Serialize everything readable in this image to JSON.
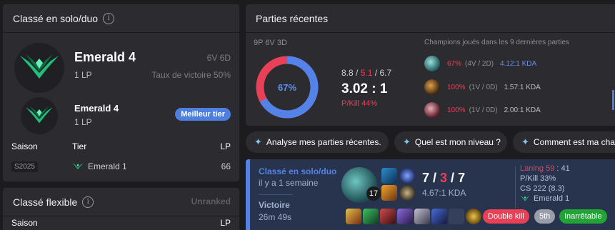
{
  "ranked_solo": {
    "title": "Classé en solo/duo",
    "info_icon": "i",
    "tier": "Emerald 4",
    "lp": "1 LP",
    "record": "6V 6D",
    "winrate": "Taux de victoire 50%",
    "peak_tier": "Emerald 4",
    "peak_lp": "1 LP",
    "peak_badge": "Meilleur tier",
    "season_headers": {
      "season": "Saison",
      "tier": "Tier",
      "lp": "LP"
    },
    "seasons": [
      {
        "season": "S2025",
        "tier": "Emerald 1",
        "lp": "66"
      }
    ]
  },
  "ranked_flex": {
    "title": "Classé flexible",
    "info_icon": "i",
    "status": "Unranked",
    "season_header": "Saison",
    "lp_header": "LP"
  },
  "recent": {
    "title": "Parties récentes",
    "summary": "9P 6V 3D",
    "winrate_pct": 67,
    "winrate_label": "67%",
    "kills": "8.8",
    "separator": "/",
    "deaths": "5.1",
    "assists": "6.7",
    "kda_ratio": "3.02 : 1",
    "pkill": "P/Kill 44%",
    "champions_title": "Champions joués dans les 9 dernières parties",
    "champions": [
      {
        "winrate": "67%",
        "record": "(4V / 2D)",
        "kda": "4.12:1 KDA",
        "icon": "champion-icon-teal"
      },
      {
        "winrate": "100%",
        "record": "(1V / 0D)",
        "kda": "1.57:1 KDA",
        "icon": "champion-icon-amber"
      },
      {
        "winrate": "100%",
        "record": "(1V / 0D)",
        "kda": "2.00:1 KDA",
        "icon": "champion-icon-crimson"
      }
    ]
  },
  "questions": [
    {
      "icon": "sparkle-icon",
      "label": "Analyse mes parties récentes."
    },
    {
      "icon": "sparkle-icon",
      "label": "Quel est mon niveau ?"
    },
    {
      "icon": "sparkle-icon",
      "label": "Comment est ma cha"
    }
  ],
  "match": {
    "queue": "Classé en solo/duo",
    "time_ago": "il y a 1 semaine",
    "result": "Victoire",
    "duration": "26m 49s",
    "champion_level": "17",
    "kills": "7",
    "deaths": "3",
    "assists": "7",
    "separator": " / ",
    "kda_ratio": "4.67:1 KDA",
    "laning_label": "Laning 59",
    "laning_sep": " : ",
    "laning_value": "41",
    "pkill": "P/Kill 33%",
    "cs": "CS 222 (8.3)",
    "rank": "Emerald 1",
    "badges": [
      {
        "label": "Double kill",
        "color": "#e84057"
      },
      {
        "label": "5th",
        "color": "#9a9ea8"
      },
      {
        "label": "Inarrêtable",
        "color": "#22a336"
      }
    ],
    "colors": {
      "win_border": "#5383e8",
      "win_bg": "#28344e"
    }
  },
  "colors": {
    "accent_blue": "#5383e8",
    "loss_red": "#e84057",
    "emerald": "#1fbf7a"
  }
}
